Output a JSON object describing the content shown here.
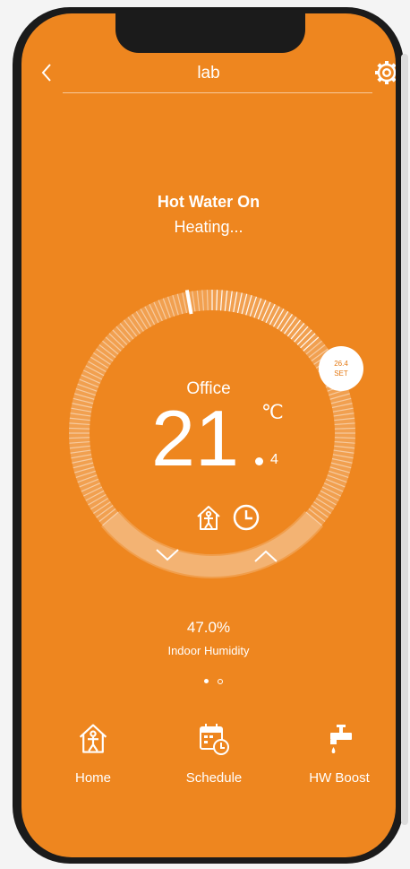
{
  "header": {
    "title": "lab"
  },
  "status": {
    "title": "Hot Water On",
    "subtitle": "Heating..."
  },
  "thermostat": {
    "zone": "Office",
    "temp_integer": "21",
    "temp_decimal": "4",
    "unit": "℃",
    "setpoint_value": "26.4",
    "setpoint_label": "SET"
  },
  "humidity": {
    "value": "47.0%",
    "label": "Indoor Humidity"
  },
  "pager": {
    "pages": 2,
    "active": 0
  },
  "nav": {
    "home_label": "Home",
    "schedule_label": "Schedule",
    "boost_label": "HW Boost"
  },
  "icons": {
    "back": "chevron-left-icon",
    "settings": "gear-icon",
    "home_mode": "home-person-icon",
    "schedule_mode": "clock-icon",
    "down": "chevron-down-icon",
    "up": "chevron-up-icon",
    "schedule": "calendar-clock-icon",
    "boost": "faucet-icon"
  },
  "colors": {
    "background": "#ee861f",
    "accent": "#ffffff",
    "setpoint_text": "#e57a14"
  }
}
